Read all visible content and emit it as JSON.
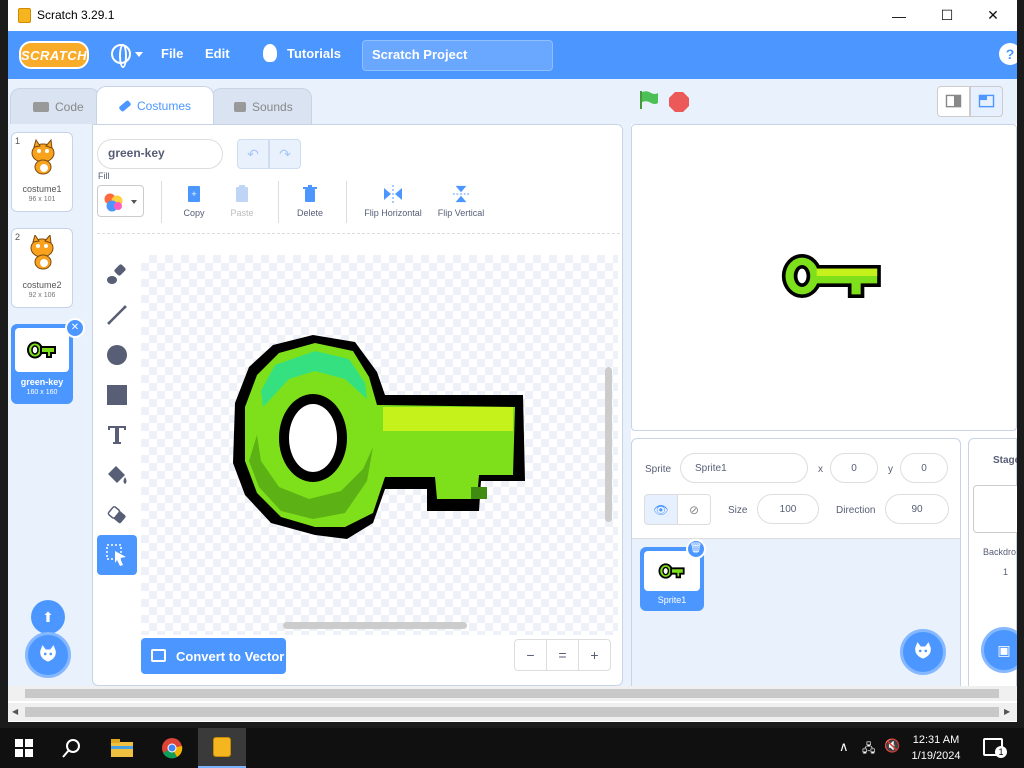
{
  "window": {
    "title": "Scratch 3.29.1",
    "controls": {
      "minimize": "—",
      "maximize": "☐",
      "close": "✕"
    }
  },
  "menubar": {
    "logo": "SCRATCH",
    "file": "File",
    "edit": "Edit",
    "tutorials": "Tutorials",
    "project_title": "Scratch Project",
    "help": "?"
  },
  "tabs": [
    {
      "label": "Code",
      "icon": "code-icon"
    },
    {
      "label": "Costumes",
      "icon": "brush-icon",
      "active": true
    },
    {
      "label": "Sounds",
      "icon": "speaker-icon"
    }
  ],
  "costumes": [
    {
      "num": "1",
      "name": "costume1",
      "size": "96 x 101"
    },
    {
      "num": "2",
      "name": "costume2",
      "size": "92 x 106"
    },
    {
      "num": "3",
      "name": "green-key",
      "size": "160 x 160",
      "selected": true
    }
  ],
  "paint": {
    "costume_name": "green-key",
    "fill_label": "Fill",
    "actions": {
      "copy": "Copy",
      "paste": "Paste",
      "delete": "Delete",
      "flip_h": "Flip Horizontal",
      "flip_v": "Flip Vertical"
    },
    "tools": [
      "brush-tool",
      "line-tool",
      "circle-tool",
      "rectangle-tool",
      "text-tool",
      "fill-tool",
      "eraser-tool",
      "select-tool"
    ],
    "convert_button": "Convert to Vector",
    "zoom": {
      "out": "−",
      "reset": "=",
      "in": "+"
    }
  },
  "sprite_info": {
    "sprite_label": "Sprite",
    "sprite_name": "Sprite1",
    "x_label": "x",
    "x": "0",
    "y_label": "y",
    "y": "0",
    "size_label": "Size",
    "size": "100",
    "direction_label": "Direction",
    "direction": "90"
  },
  "sprites": [
    {
      "name": "Sprite1"
    }
  ],
  "stage_panel": {
    "title": "Stage",
    "backdrops_label": "Backdro",
    "backdrop_count": "1"
  },
  "taskbar": {
    "time": "12:31 AM",
    "date": "1/19/2024",
    "notification_count": "1"
  },
  "colors": {
    "accent": "#4c97ff",
    "key_green": "#7ee01a",
    "key_light": "#c5f21a",
    "key_dark": "#3f8a10"
  }
}
